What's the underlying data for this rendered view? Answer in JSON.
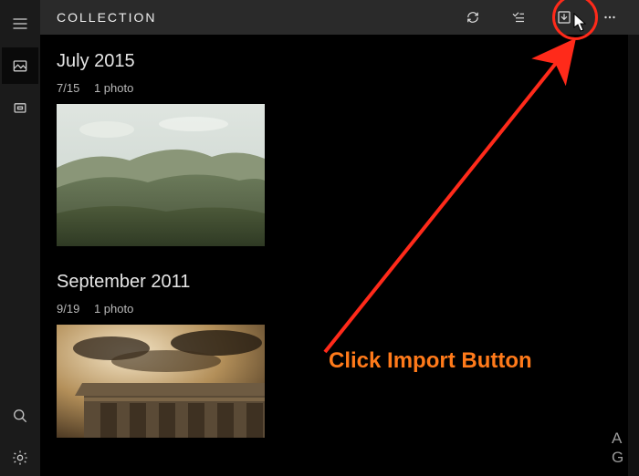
{
  "header": {
    "title": "COLLECTION"
  },
  "icons": {
    "menu": "menu-icon",
    "collection": "collection-icon",
    "albums": "albums-icon",
    "search": "search-icon",
    "settings": "settings-icon",
    "refresh": "refresh-icon",
    "select": "select-icon",
    "import": "import-icon",
    "more": "more-icon"
  },
  "months": [
    {
      "title": "July 2015",
      "date": "7/15",
      "count": "1 photo"
    },
    {
      "title": "September 2011",
      "date": "9/19",
      "count": "1 photo"
    }
  ],
  "rightEdge": {
    "line1": "A",
    "line2": "G"
  },
  "annotation": {
    "text": "Click Import Button"
  }
}
